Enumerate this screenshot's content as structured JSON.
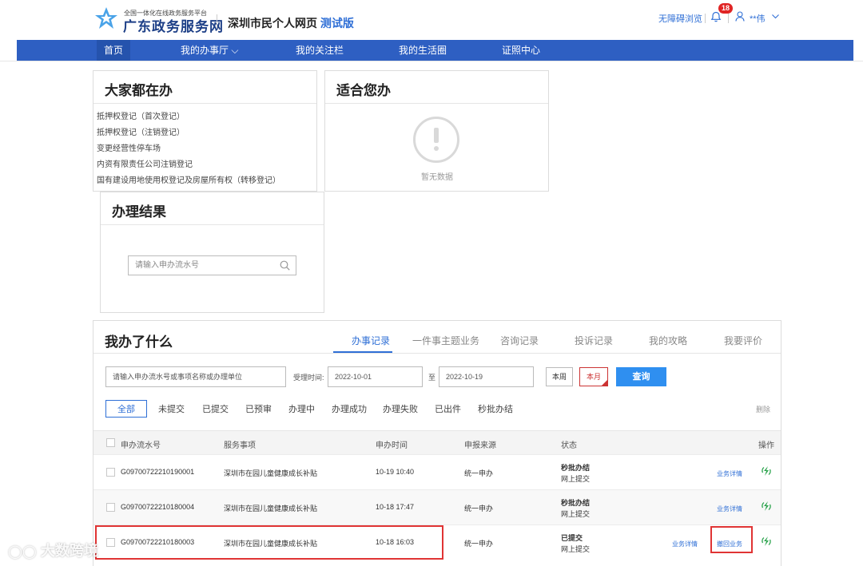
{
  "header": {
    "logo_subtitle": "全国一体化在线政务服务平台",
    "logo_title": "广东政务服务网",
    "site_name": "深圳市民个人网页",
    "site_tag": "测试版",
    "accessibility": "无障碍浏览",
    "notification_count": "18",
    "user_name": "**伟",
    "icons": [
      "logo-icon",
      "bell-icon",
      "user-icon",
      "chevron-down-icon"
    ]
  },
  "nav": {
    "items": [
      {
        "label": "首页",
        "active": true
      },
      {
        "label": "我的办事厅 ⌵"
      },
      {
        "label": "我的关注栏"
      },
      {
        "label": "我的生活圈"
      },
      {
        "label": "证照中心"
      }
    ]
  },
  "popular": {
    "title": "大家都在办",
    "items": [
      "抵押权登记（首次登记）",
      "抵押权登记（注销登记）",
      "变更经营性停车场",
      "内资有限责任公司注销登记",
      "国有建设用地使用权登记及房屋所有权（转移登记）"
    ]
  },
  "suitable": {
    "title": "适合您办",
    "empty_text": "暂无数据"
  },
  "result": {
    "title": "办理结果",
    "placeholder": "请输入申办流水号"
  },
  "records": {
    "title": "我办了什么",
    "tabs": [
      "办事记录",
      "一件事主题业务",
      "咨询记录",
      "投诉记录",
      "我的攻略",
      "我要评价"
    ],
    "active_tab": "办事记录",
    "search_placeholder": "请输入申办流水号或事项名称或办理单位",
    "time_label": "受理时间:",
    "date_from": "2022-10-01",
    "date_sep": "至",
    "date_to": "2022-10-19",
    "btn_week": "本周",
    "btn_month": "本月",
    "btn_query": "查询",
    "filters": [
      "全部",
      "未提交",
      "已提交",
      "已预审",
      "办理中",
      "办理成功",
      "办理失败",
      "已出件",
      "秒批办结"
    ],
    "active_filter": "全部",
    "delete_label": "删除",
    "columns": [
      "申办流水号",
      "服务事项",
      "申办时间",
      "申报来源",
      "状态",
      "操作"
    ],
    "rows": [
      {
        "id": "G09700722210190001",
        "item": "深圳市在园儿童健康成长补贴",
        "time": "10-19 10:40",
        "source": "统一申办",
        "status": "秒批办结",
        "status_sub": "网上提交",
        "actions": [
          "业务详情"
        ]
      },
      {
        "id": "G09700722210180004",
        "item": "深圳市在园儿童健康成长补贴",
        "time": "10-18 17:47",
        "source": "统一申办",
        "status": "秒批办结",
        "status_sub": "网上提交",
        "actions": [
          "业务详情"
        ]
      },
      {
        "id": "G09700722210180003",
        "item": "深圳市在园儿童健康成长补贴",
        "time": "10-18 16:03",
        "source": "统一申办",
        "status": "已提交",
        "status_sub": "网上提交",
        "actions": [
          "业务详情",
          "撤回业务"
        ]
      }
    ]
  },
  "watermark": "大数跨境",
  "colors": {
    "nav": "#2e5fc2",
    "accent": "#2f6fd6",
    "highlight": "#e03434",
    "refresh": "#2ea44f"
  }
}
